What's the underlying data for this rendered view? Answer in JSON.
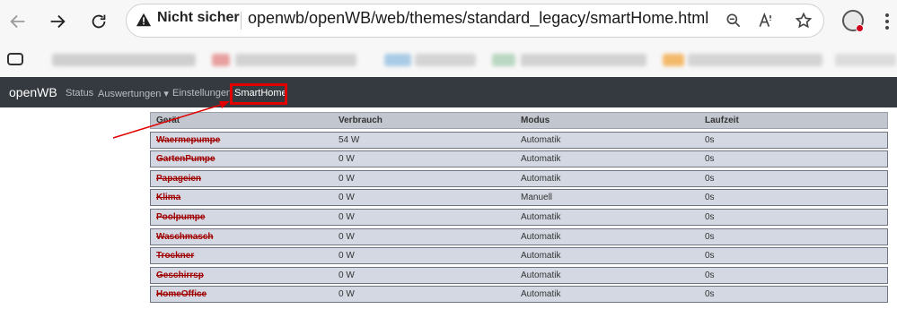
{
  "browser": {
    "security_label": "Nicht sicher",
    "url": "openwb/openWB/web/themes/standard_legacy/smartHome.html"
  },
  "app": {
    "brand": "openWB",
    "nav": [
      {
        "label": "Status"
      },
      {
        "label": "Auswertungen ▾"
      },
      {
        "label": "Einstellungen"
      },
      {
        "label": "SmartHome"
      }
    ]
  },
  "table": {
    "columns": [
      "Gerät",
      "Verbrauch",
      "Modus",
      "Laufzeit"
    ],
    "rows": [
      {
        "name": "Waermepumpe",
        "usage": "54 W",
        "mode": "Automatik",
        "runtime": "0s"
      },
      {
        "name": "GartenPumpe",
        "usage": "0 W",
        "mode": "Automatik",
        "runtime": "0s"
      },
      {
        "name": "Papageien",
        "usage": "0 W",
        "mode": "Automatik",
        "runtime": "0s"
      },
      {
        "name": "Klima",
        "usage": "0 W",
        "mode": "Manuell",
        "runtime": "0s"
      },
      {
        "name": "Poolpumpe",
        "usage": "0 W",
        "mode": "Automatik",
        "runtime": "0s"
      },
      {
        "name": "Waschmasch",
        "usage": "0 W",
        "mode": "Automatik",
        "runtime": "0s"
      },
      {
        "name": "Trockner",
        "usage": "0 W",
        "mode": "Automatik",
        "runtime": "0s"
      },
      {
        "name": "Geschirrsp",
        "usage": "0 W",
        "mode": "Automatik",
        "runtime": "0s"
      },
      {
        "name": "HomeOffice",
        "usage": "0 W",
        "mode": "Automatik",
        "runtime": "0s"
      }
    ]
  },
  "colors": {
    "navbar": "#343a40",
    "table_header": "#c2c7cf",
    "row_bg": "#d3d8e3",
    "device_name": "#a00000",
    "annotation": "#e00000"
  },
  "icons": [
    "back-icon",
    "forward-icon",
    "reload-icon",
    "warning-icon",
    "zoom-icon",
    "read-aloud-icon",
    "favorite-star-icon",
    "profile-icon",
    "menu-icon",
    "tab-actions-icon"
  ]
}
